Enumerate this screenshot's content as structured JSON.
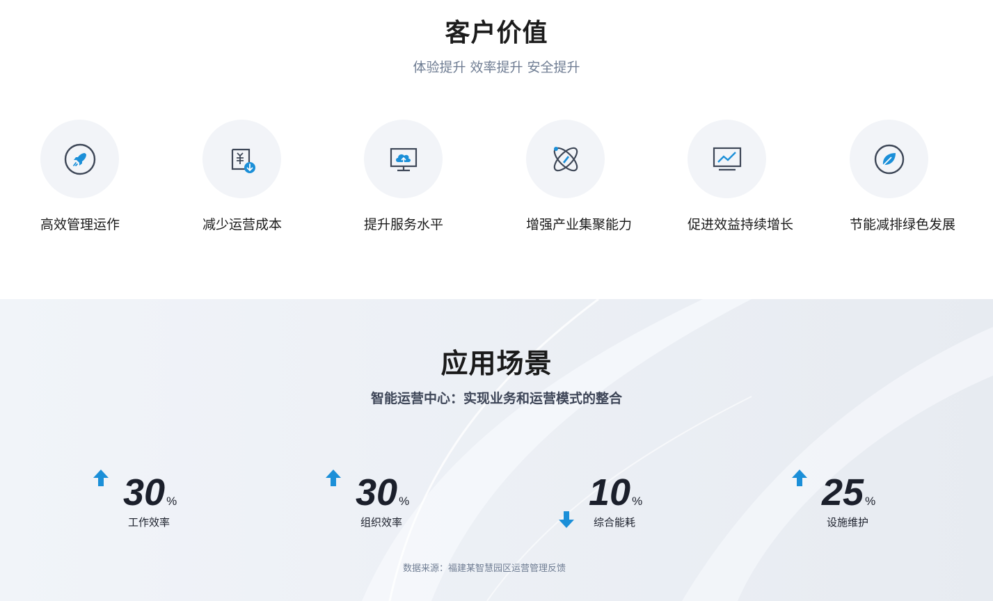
{
  "value": {
    "title": "客户价值",
    "subtitle": "体验提升 效率提升 安全提升",
    "items": [
      {
        "label": "高效管理运作",
        "icon": "rocket-icon"
      },
      {
        "label": "减少运营成本",
        "icon": "cost-reduction-icon"
      },
      {
        "label": "提升服务水平",
        "icon": "cloud-upload-monitor-icon"
      },
      {
        "label": "增强产业集聚能力",
        "icon": "atom-orbit-icon"
      },
      {
        "label": "促进效益持续增长",
        "icon": "growth-chart-icon"
      },
      {
        "label": "节能减排绿色发展",
        "icon": "leaf-icon"
      }
    ]
  },
  "scene": {
    "title": "应用场景",
    "subtitle": "智能运营中心：实现业务和运营模式的整合",
    "stats": [
      {
        "value": "30",
        "unit": "%",
        "caption": "工作效率",
        "direction": "up"
      },
      {
        "value": "30",
        "unit": "%",
        "caption": "组织效率",
        "direction": "up"
      },
      {
        "value": "10",
        "unit": "%",
        "caption": "综合能耗",
        "direction": "down"
      },
      {
        "value": "25",
        "unit": "%",
        "caption": "设施维护",
        "direction": "up"
      }
    ],
    "source": "数据来源：福建某智慧园区运营管理反馈"
  },
  "colors": {
    "accent": "#1b8fd8",
    "icon_stroke": "#3d4656",
    "circle_bg": "#f2f4f8",
    "section_bg": "#eef2f7"
  }
}
